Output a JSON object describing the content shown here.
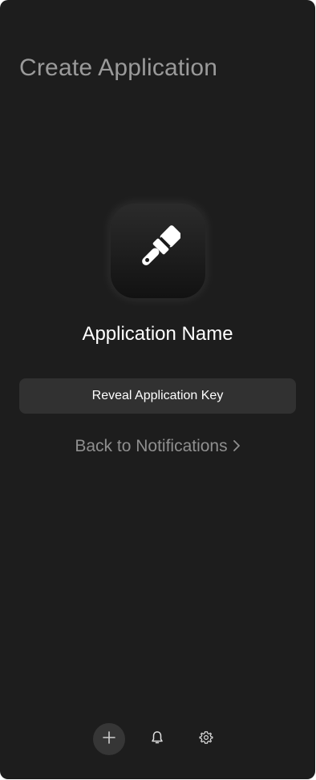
{
  "header": {
    "title": "Create Application"
  },
  "app": {
    "icon": "paintbrush-icon",
    "name": "Application Name"
  },
  "actions": {
    "reveal_key_label": "Reveal Application Key",
    "back_label": "Back to Notifications",
    "back_chevron": "›"
  },
  "nav": {
    "items": [
      {
        "icon": "plus-icon",
        "active": true
      },
      {
        "icon": "bell-icon",
        "active": false
      },
      {
        "icon": "gear-icon",
        "active": false
      }
    ]
  },
  "colors": {
    "background": "#1d1d1d",
    "button": "#313131",
    "title_text": "#9a9a9a",
    "primary_text": "#ffffff"
  }
}
